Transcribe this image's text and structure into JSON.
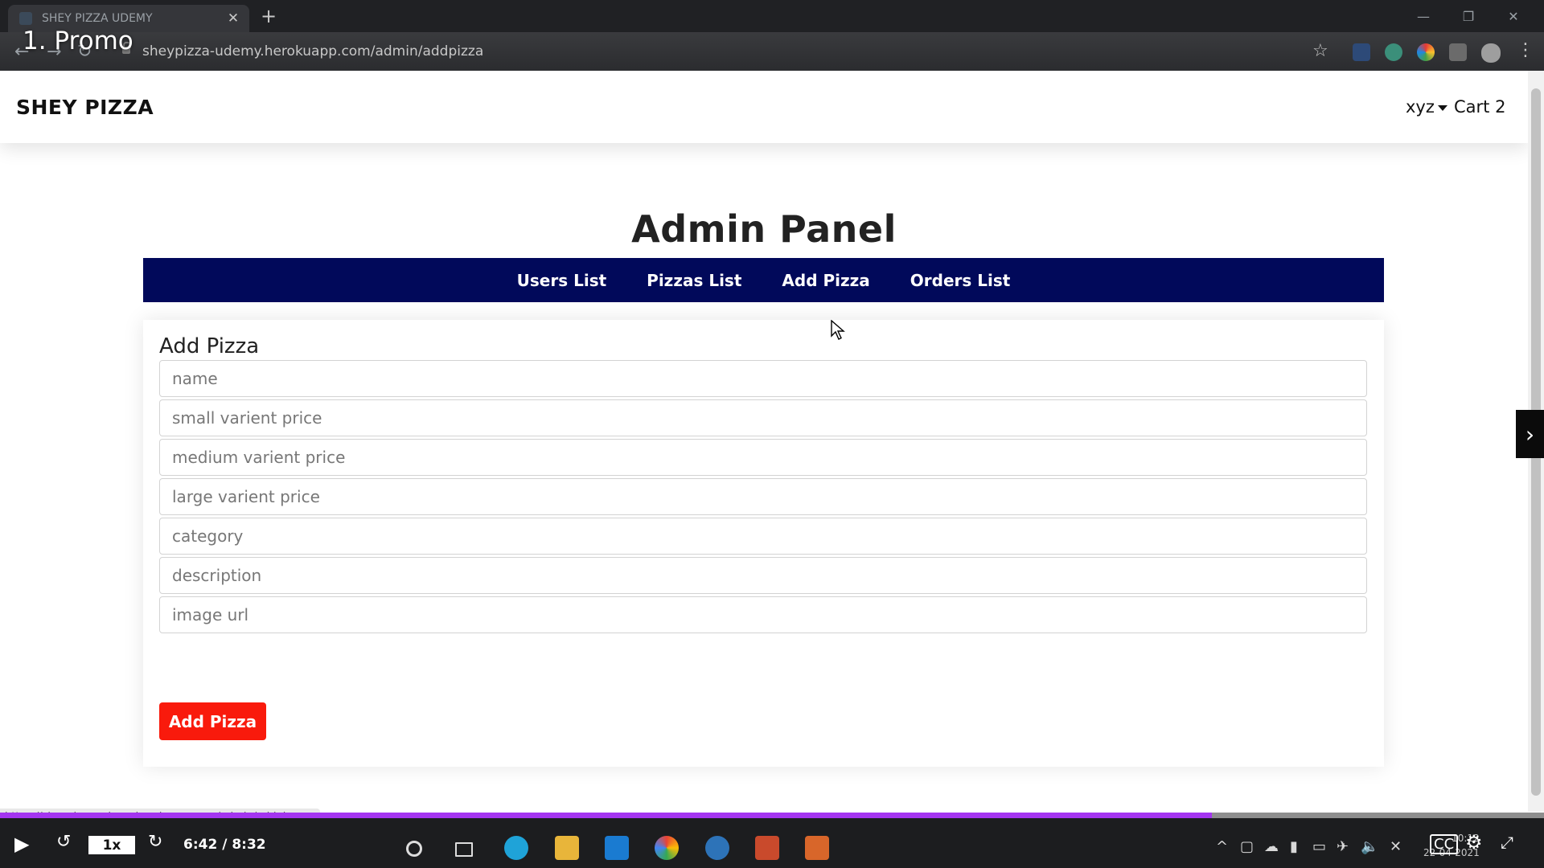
{
  "browser": {
    "tab_title": "SHEY PIZZA UDEMY",
    "url": "sheypizza-udemy.herokuapp.com/admin/addpizza",
    "status_url": "https://sheypizza-udemy.herokuapp.com/admin/addpizza"
  },
  "overlay": {
    "promo_label": "1. Promo"
  },
  "navbar": {
    "brand": "SHEY PIZZA",
    "user_menu": "xyz",
    "cart": "Cart 2"
  },
  "admin": {
    "title": "Admin Panel",
    "tabs": [
      {
        "label": "Users List"
      },
      {
        "label": "Pizzas List"
      },
      {
        "label": "Add Pizza"
      },
      {
        "label": "Orders List"
      }
    ]
  },
  "form": {
    "title": "Add Pizza",
    "fields": [
      {
        "placeholder": "name"
      },
      {
        "placeholder": "small varient price"
      },
      {
        "placeholder": "medium varient price"
      },
      {
        "placeholder": "large varient price"
      },
      {
        "placeholder": "category"
      },
      {
        "placeholder": "description"
      },
      {
        "placeholder": "image url"
      }
    ],
    "submit_label": "Add Pizza"
  },
  "player": {
    "speed": "1x",
    "time": "6:42 / 8:32",
    "progress": 0.785
  },
  "system": {
    "clock_time": "10:12",
    "clock_date": "22-04-2021"
  },
  "colors": {
    "admin_bar": "#01095a",
    "submit_button": "#f91a0c",
    "progress": "#a435f0"
  }
}
